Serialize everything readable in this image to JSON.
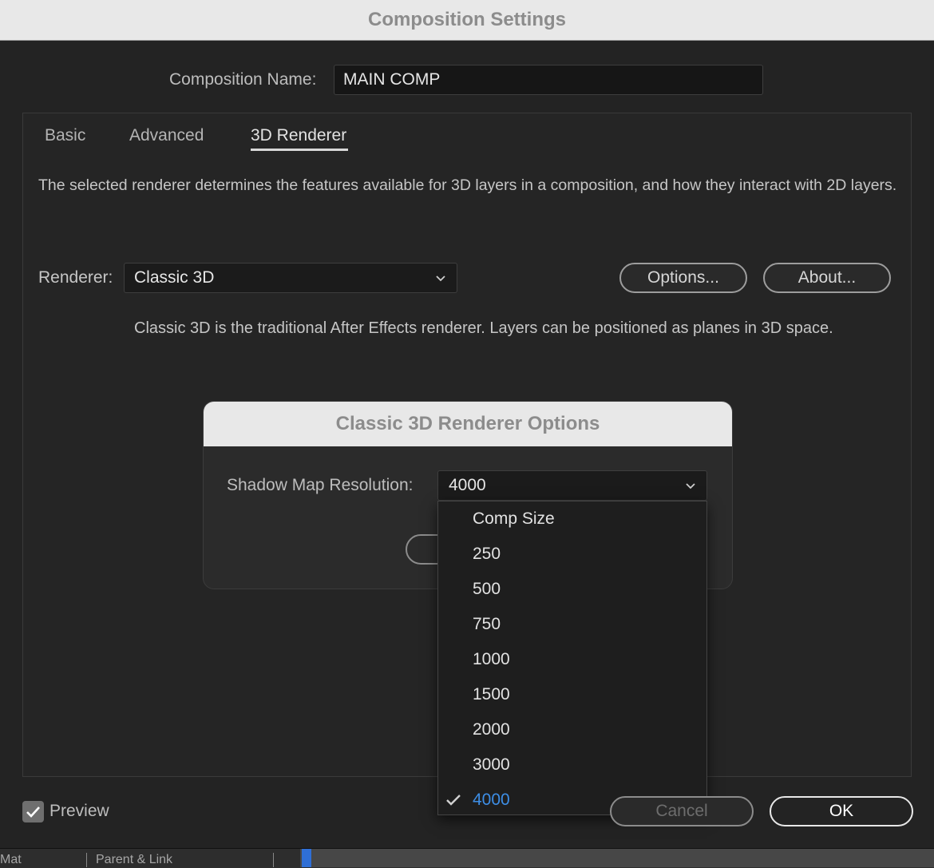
{
  "window": {
    "title": "Composition Settings"
  },
  "composition": {
    "name_label": "Composition Name:",
    "name_value": "MAIN COMP"
  },
  "tabs": [
    {
      "label": "Basic",
      "active": false
    },
    {
      "label": "Advanced",
      "active": false
    },
    {
      "label": "3D Renderer",
      "active": true
    }
  ],
  "renderer_tab": {
    "description": "The selected renderer determines the features available for 3D layers in a composition, and how they interact with 2D layers.",
    "renderer_label": "Renderer:",
    "renderer_value": "Classic 3D",
    "options_button": "Options...",
    "about_button": "About...",
    "renderer_description": "Classic 3D is the traditional After Effects renderer. Layers can be positioned as planes in 3D space."
  },
  "options_dialog": {
    "title": "Classic 3D Renderer Options",
    "shadow_label": "Shadow Map Resolution:",
    "shadow_value": "4000",
    "menu_items": [
      "Comp Size",
      "250",
      "500",
      "750",
      "1000",
      "1500",
      "2000",
      "3000",
      "4000"
    ],
    "selected_item": "4000"
  },
  "footer": {
    "preview_label": "Preview",
    "preview_checked": true,
    "cancel_button": "Cancel",
    "ok_button": "OK"
  },
  "timeline_header": {
    "col_mat": "Mat",
    "col_parent": "Parent & Link"
  },
  "colors": {
    "accent": "#3d8ee6",
    "playhead": "#2f6fd6"
  }
}
